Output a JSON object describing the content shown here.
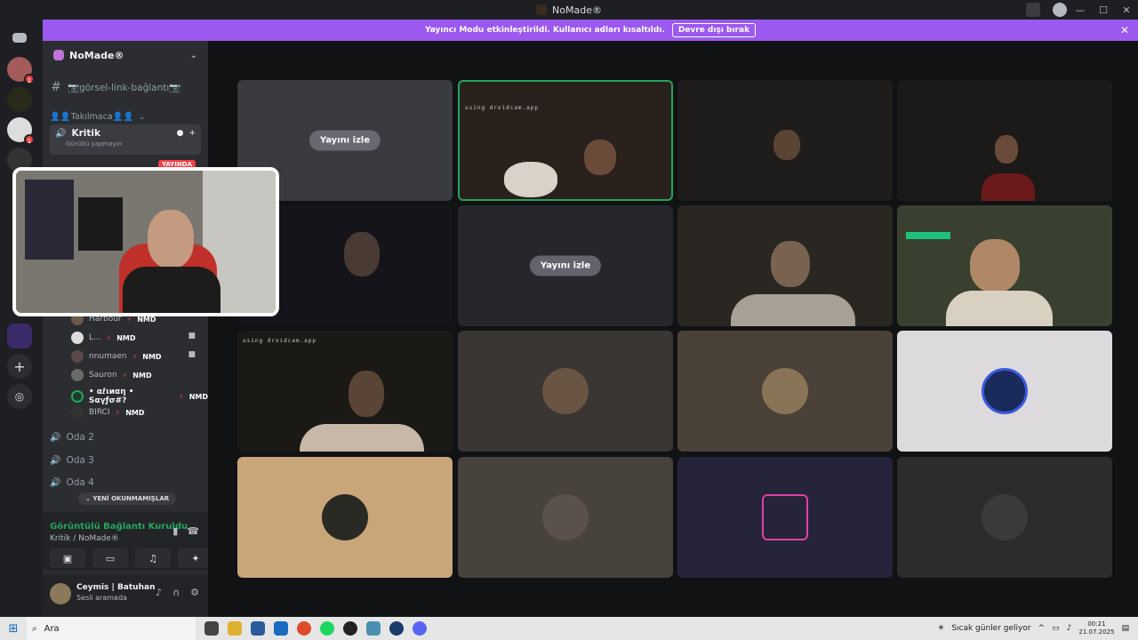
{
  "window": {
    "title": "NoMade®",
    "controls": [
      "—",
      "☐",
      "✕"
    ]
  },
  "banner": {
    "text": "Yayıncı Modu etkinleştirildi. Kullanıcı adları kısaltıldı.",
    "button": "Devre dışı bırak",
    "close": "✕"
  },
  "server": {
    "name": "NoMade®"
  },
  "channels": {
    "text_channel": "📷görsel-link-bağlantı📷",
    "category": "👤👤Takılmaca👤👤",
    "active_voice": {
      "name": "Kritik",
      "status": "Gürültü yapmayın",
      "live_badge": "YAYINDA"
    },
    "voice_rooms": [
      "Oda 2",
      "Oda 3",
      "Oda 4"
    ],
    "unread_pill": "YENİ OKUNMAMIŞLAR"
  },
  "members": [
    {
      "name": "Harbour",
      "tag": "NMD"
    },
    {
      "name": "L...",
      "tag": "NMD",
      "cam": true
    },
    {
      "name": "nnumaen",
      "tag": "NMD",
      "cam": true
    },
    {
      "name": "Sauron",
      "tag": "NMD"
    },
    {
      "name": "• αℓιиαη • Sαγƒσ#?",
      "tag": "NMD"
    },
    {
      "name": "BIRCI",
      "tag": "NMD"
    }
  ],
  "voice_panel": {
    "status": "Görüntülü Bağlantı Kuruldu",
    "channel": "Kritik / NoMade®"
  },
  "user": {
    "name": "Ceymis | Batuhan",
    "status": "Sesli aramada"
  },
  "tiles": {
    "watch_label": "Yayını izle",
    "droidcam": "using droidcam.app"
  },
  "taskbar": {
    "search": "Ara",
    "weather": "Sıcak günler geliyor",
    "time": "00:21",
    "date": "21.07.2025"
  },
  "colors": {
    "accent": "#9b59f0",
    "online": "#23a55a",
    "danger": "#f23f43"
  }
}
